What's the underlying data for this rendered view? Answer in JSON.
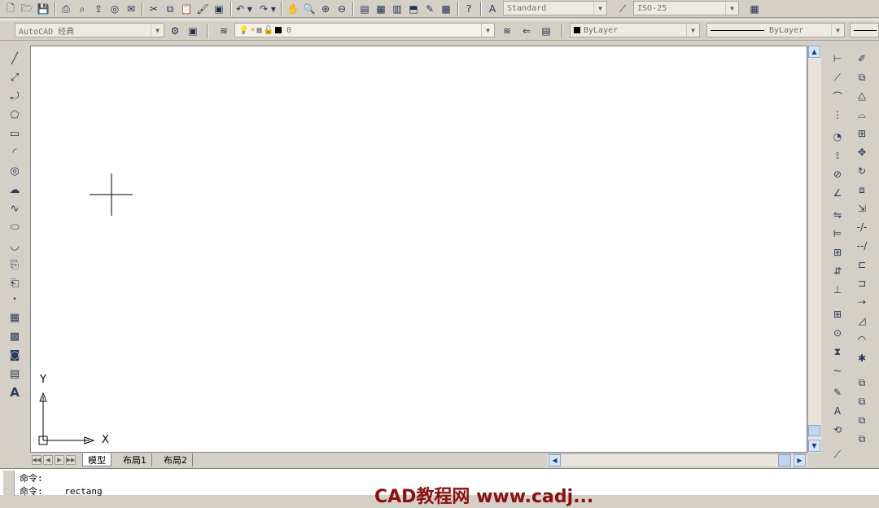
{
  "toolbar_top": {
    "text_style": "Standard",
    "dim_style": "ISO-25"
  },
  "toolbar_second": {
    "workspace": "AutoCAD 经典",
    "layer_current": "0",
    "color": "ByLayer",
    "linetype": "ByLayer"
  },
  "canvas": {
    "ucs_y_label": "Y",
    "ucs_x_label": "X"
  },
  "layout_tabs": [
    {
      "label": "模型",
      "active": true
    },
    {
      "label": "布局1",
      "active": false
    },
    {
      "label": "布局2",
      "active": false
    }
  ],
  "command": {
    "line1": "命令:",
    "line2_prompt": "命令:",
    "line2_value": "rectang"
  },
  "watermark": "CAD教程网 www.cadj..."
}
